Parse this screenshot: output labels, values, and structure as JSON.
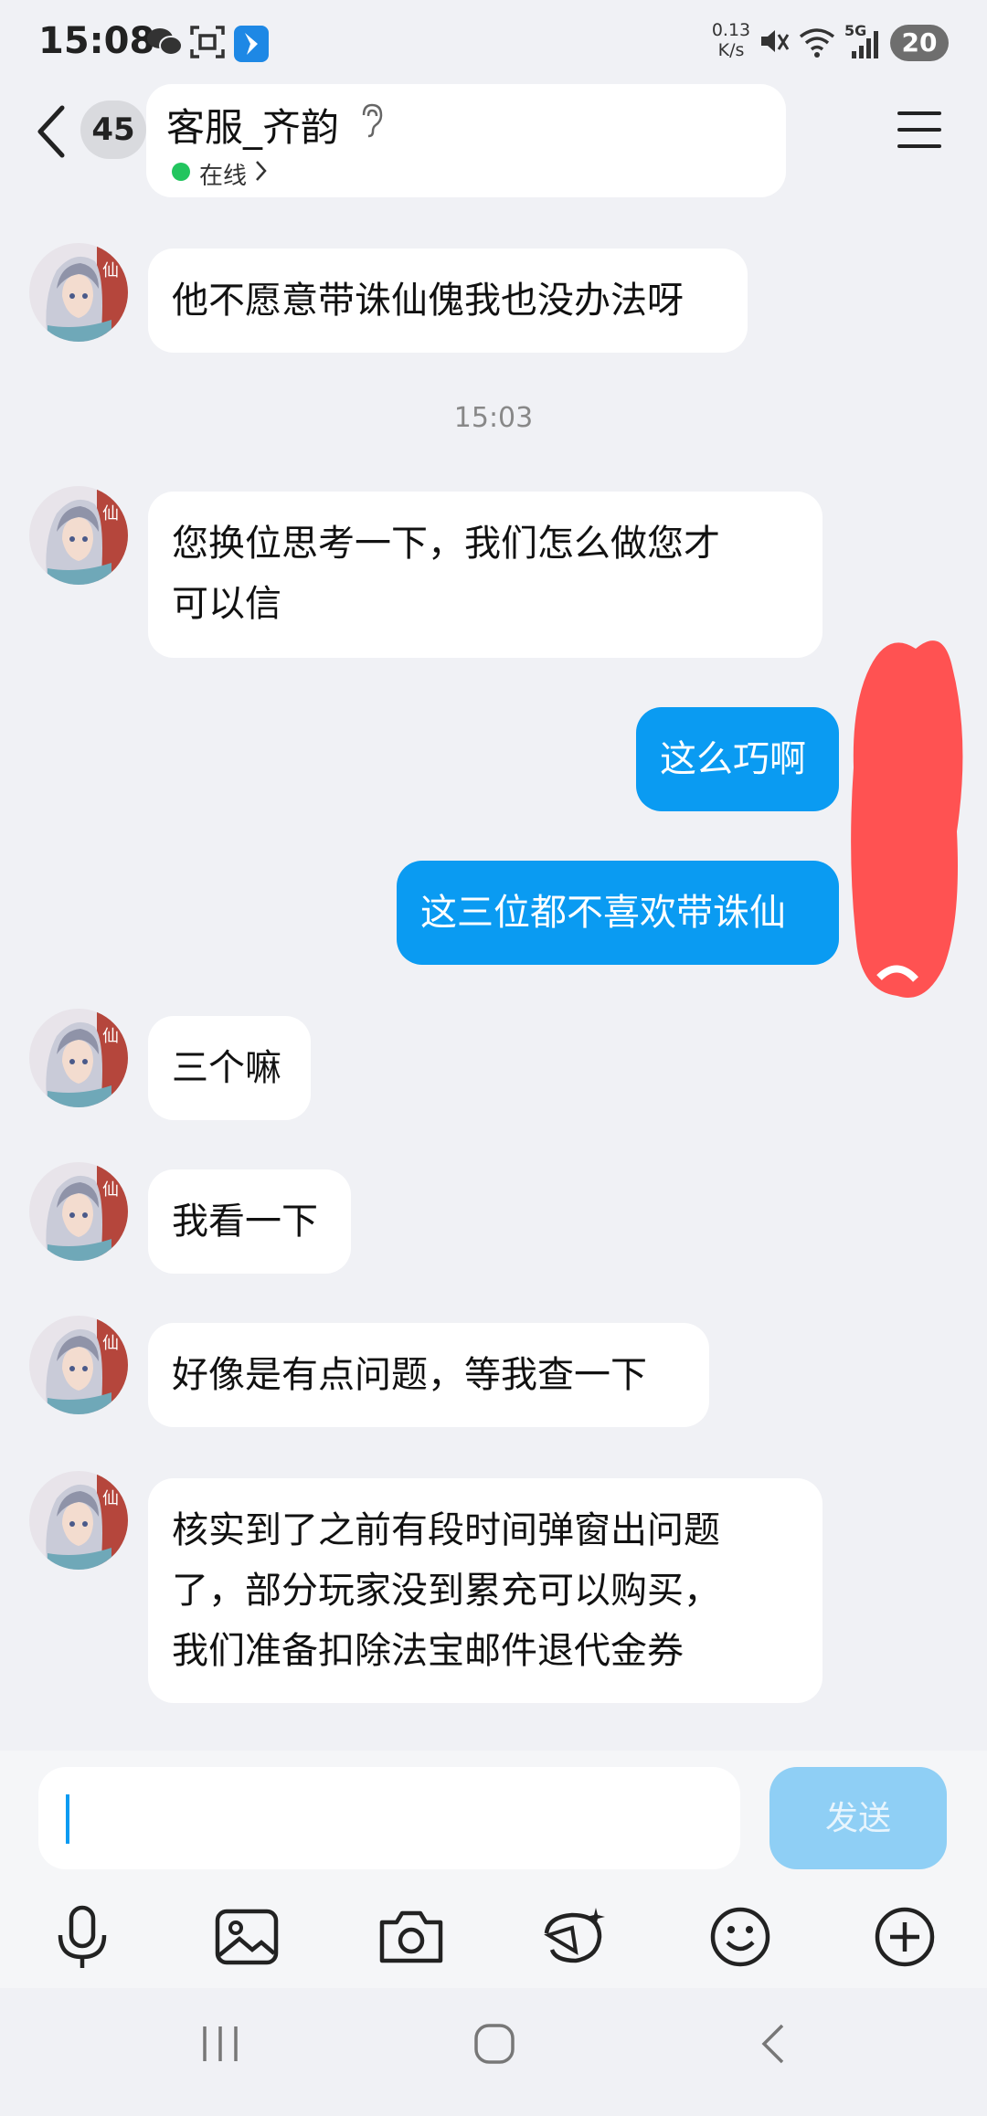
{
  "status_bar": {
    "time": "15:08",
    "speed_value": "0.13",
    "speed_unit": "K/s",
    "network": "5G",
    "battery": "20"
  },
  "header": {
    "unread_count": "45",
    "title": "客服_齐韵",
    "status": "在线"
  },
  "messages": [
    {
      "side": "in",
      "text": "他不愿意带诛仙傀我也没办法呀"
    },
    {
      "type": "time",
      "text": "15:03"
    },
    {
      "side": "in",
      "text": "您换位思考一下，我们怎么做您才\n可以信"
    },
    {
      "side": "out",
      "text": "这么巧啊"
    },
    {
      "side": "out",
      "text": "这三位都不喜欢带诛仙"
    },
    {
      "side": "in",
      "text": "三个嘛"
    },
    {
      "side": "in",
      "text": "我看一下"
    },
    {
      "side": "in",
      "text": "好像是有点问题，等我查一下"
    },
    {
      "side": "in",
      "text": "核实到了之前有段时间弹窗出问题\n了，部分玩家没到累充可以购买，\n我们准备扣除法宝邮件退代金券"
    }
  ],
  "input": {
    "value": "",
    "send_label": "发送"
  },
  "toolbar_icons": [
    "microphone-icon",
    "image-icon",
    "camera-icon",
    "sticker-icon",
    "emoji-icon",
    "plus-icon"
  ],
  "colors": {
    "accent": "#0a9bf2",
    "background": "#f0f1f5",
    "online": "#22c55e",
    "redaction": "#ff5252"
  }
}
